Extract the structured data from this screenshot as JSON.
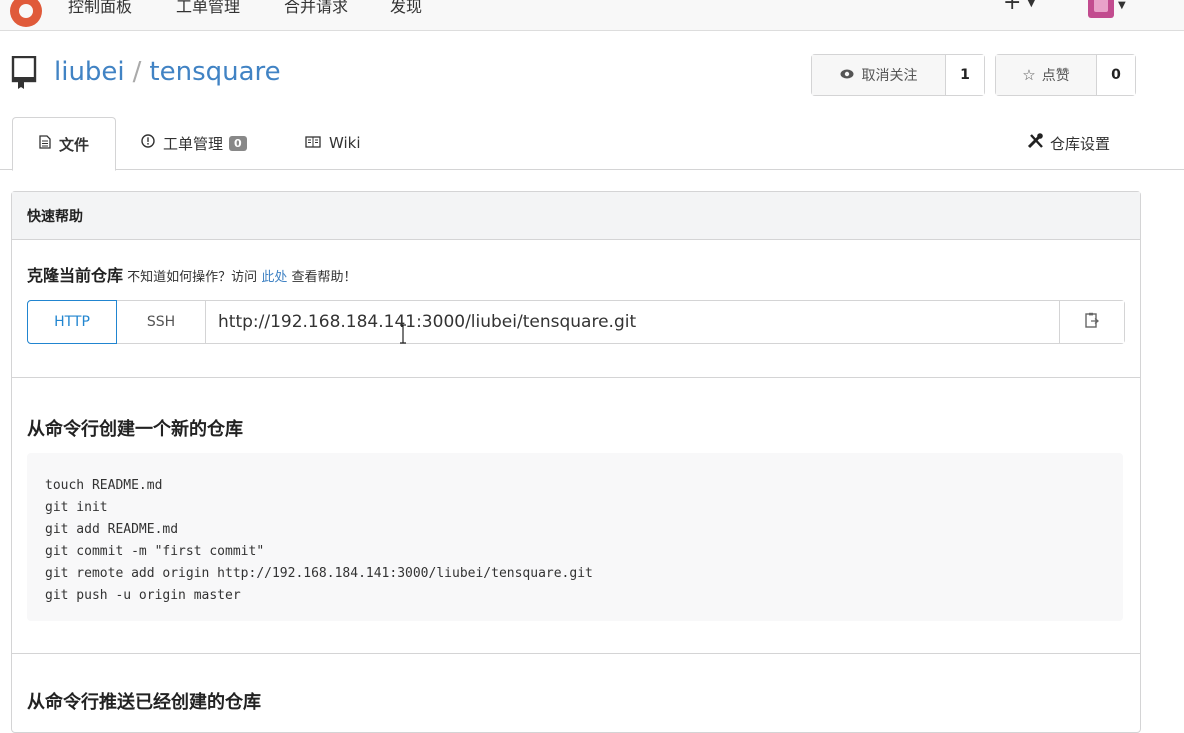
{
  "nav": {
    "items": [
      "控制面板",
      "工单管理",
      "合并请求",
      "发现"
    ],
    "plus": "+",
    "avatar_color": "#c24c8f",
    "logo_color": "#e05a3a"
  },
  "repo": {
    "owner": "liubei",
    "separator": "/",
    "name": "tensquare",
    "unwatch_label": "取消关注",
    "watch_count": "1",
    "star_label": "点赞",
    "star_count": "0",
    "accent": "#4183c4"
  },
  "tabs": {
    "files": "文件",
    "issues": "工单管理",
    "issues_count": "0",
    "wiki": "Wiki",
    "settings": "仓库设置"
  },
  "panel": {
    "header": "快速帮助",
    "clone_title": "克隆当前仓库",
    "clone_hint_pre": "不知道如何操作？访问",
    "clone_hint_link": "此处",
    "clone_hint_post": "查看帮助！",
    "protocols": [
      "HTTP",
      "SSH"
    ],
    "clone_url": "http://192.168.184.141:3000/liubei/tensquare.git",
    "new_repo_title": "从命令行创建一个新的仓库",
    "new_repo_commands": [
      "touch README.md",
      "git init",
      "git add README.md",
      "git commit -m \"first commit\"",
      "git remote add origin http://192.168.184.141:3000/liubei/tensquare.git",
      "git push -u origin master"
    ],
    "push_existing_title": "从命令行推送已经创建的仓库"
  }
}
